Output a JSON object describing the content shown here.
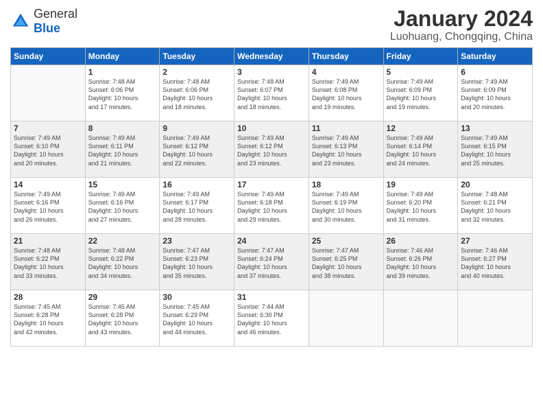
{
  "logo": {
    "general": "General",
    "blue": "Blue"
  },
  "header": {
    "month": "January 2024",
    "location": "Luohuang, Chongqing, China"
  },
  "weekdays": [
    "Sunday",
    "Monday",
    "Tuesday",
    "Wednesday",
    "Thursday",
    "Friday",
    "Saturday"
  ],
  "weeks": [
    {
      "shaded": false,
      "days": [
        {
          "num": "",
          "info": ""
        },
        {
          "num": "1",
          "info": "Sunrise: 7:48 AM\nSunset: 6:06 PM\nDaylight: 10 hours\nand 17 minutes."
        },
        {
          "num": "2",
          "info": "Sunrise: 7:48 AM\nSunset: 6:06 PM\nDaylight: 10 hours\nand 18 minutes."
        },
        {
          "num": "3",
          "info": "Sunrise: 7:48 AM\nSunset: 6:07 PM\nDaylight: 10 hours\nand 18 minutes."
        },
        {
          "num": "4",
          "info": "Sunrise: 7:49 AM\nSunset: 6:08 PM\nDaylight: 10 hours\nand 19 minutes."
        },
        {
          "num": "5",
          "info": "Sunrise: 7:49 AM\nSunset: 6:09 PM\nDaylight: 10 hours\nand 19 minutes."
        },
        {
          "num": "6",
          "info": "Sunrise: 7:49 AM\nSunset: 6:09 PM\nDaylight: 10 hours\nand 20 minutes."
        }
      ]
    },
    {
      "shaded": true,
      "days": [
        {
          "num": "7",
          "info": "Sunrise: 7:49 AM\nSunset: 6:10 PM\nDaylight: 10 hours\nand 20 minutes."
        },
        {
          "num": "8",
          "info": "Sunrise: 7:49 AM\nSunset: 6:11 PM\nDaylight: 10 hours\nand 21 minutes."
        },
        {
          "num": "9",
          "info": "Sunrise: 7:49 AM\nSunset: 6:12 PM\nDaylight: 10 hours\nand 22 minutes."
        },
        {
          "num": "10",
          "info": "Sunrise: 7:49 AM\nSunset: 6:12 PM\nDaylight: 10 hours\nand 23 minutes."
        },
        {
          "num": "11",
          "info": "Sunrise: 7:49 AM\nSunset: 6:13 PM\nDaylight: 10 hours\nand 23 minutes."
        },
        {
          "num": "12",
          "info": "Sunrise: 7:49 AM\nSunset: 6:14 PM\nDaylight: 10 hours\nand 24 minutes."
        },
        {
          "num": "13",
          "info": "Sunrise: 7:49 AM\nSunset: 6:15 PM\nDaylight: 10 hours\nand 25 minutes."
        }
      ]
    },
    {
      "shaded": false,
      "days": [
        {
          "num": "14",
          "info": "Sunrise: 7:49 AM\nSunset: 6:16 PM\nDaylight: 10 hours\nand 26 minutes."
        },
        {
          "num": "15",
          "info": "Sunrise: 7:49 AM\nSunset: 6:16 PM\nDaylight: 10 hours\nand 27 minutes."
        },
        {
          "num": "16",
          "info": "Sunrise: 7:49 AM\nSunset: 6:17 PM\nDaylight: 10 hours\nand 28 minutes."
        },
        {
          "num": "17",
          "info": "Sunrise: 7:49 AM\nSunset: 6:18 PM\nDaylight: 10 hours\nand 29 minutes."
        },
        {
          "num": "18",
          "info": "Sunrise: 7:49 AM\nSunset: 6:19 PM\nDaylight: 10 hours\nand 30 minutes."
        },
        {
          "num": "19",
          "info": "Sunrise: 7:49 AM\nSunset: 6:20 PM\nDaylight: 10 hours\nand 31 minutes."
        },
        {
          "num": "20",
          "info": "Sunrise: 7:48 AM\nSunset: 6:21 PM\nDaylight: 10 hours\nand 32 minutes."
        }
      ]
    },
    {
      "shaded": true,
      "days": [
        {
          "num": "21",
          "info": "Sunrise: 7:48 AM\nSunset: 6:22 PM\nDaylight: 10 hours\nand 33 minutes."
        },
        {
          "num": "22",
          "info": "Sunrise: 7:48 AM\nSunset: 6:22 PM\nDaylight: 10 hours\nand 34 minutes."
        },
        {
          "num": "23",
          "info": "Sunrise: 7:47 AM\nSunset: 6:23 PM\nDaylight: 10 hours\nand 35 minutes."
        },
        {
          "num": "24",
          "info": "Sunrise: 7:47 AM\nSunset: 6:24 PM\nDaylight: 10 hours\nand 37 minutes."
        },
        {
          "num": "25",
          "info": "Sunrise: 7:47 AM\nSunset: 6:25 PM\nDaylight: 10 hours\nand 38 minutes."
        },
        {
          "num": "26",
          "info": "Sunrise: 7:46 AM\nSunset: 6:26 PM\nDaylight: 10 hours\nand 39 minutes."
        },
        {
          "num": "27",
          "info": "Sunrise: 7:46 AM\nSunset: 6:27 PM\nDaylight: 10 hours\nand 40 minutes."
        }
      ]
    },
    {
      "shaded": false,
      "days": [
        {
          "num": "28",
          "info": "Sunrise: 7:45 AM\nSunset: 6:28 PM\nDaylight: 10 hours\nand 42 minutes."
        },
        {
          "num": "29",
          "info": "Sunrise: 7:45 AM\nSunset: 6:28 PM\nDaylight: 10 hours\nand 43 minutes."
        },
        {
          "num": "30",
          "info": "Sunrise: 7:45 AM\nSunset: 6:29 PM\nDaylight: 10 hours\nand 44 minutes."
        },
        {
          "num": "31",
          "info": "Sunrise: 7:44 AM\nSunset: 6:30 PM\nDaylight: 10 hours\nand 46 minutes."
        },
        {
          "num": "",
          "info": ""
        },
        {
          "num": "",
          "info": ""
        },
        {
          "num": "",
          "info": ""
        }
      ]
    }
  ]
}
